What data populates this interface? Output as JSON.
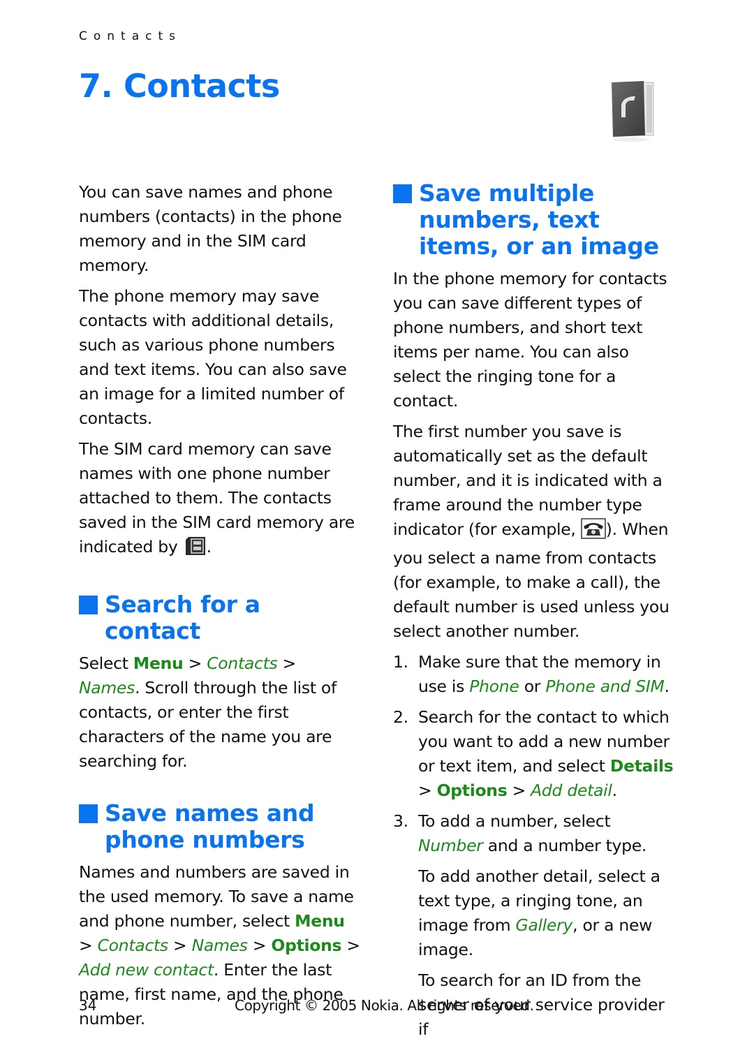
{
  "header": {
    "running_head": "Contacts",
    "chapter_title": "7. Contacts",
    "chapter_icon": "contacts-book-icon"
  },
  "colors": {
    "heading_blue": "#0A74F0",
    "menu_green": "#1B8A1B",
    "text": "#111111"
  },
  "left_column": {
    "intro_paragraphs": [
      "You can save names and phone numbers (contacts) in the phone memory and in the SIM card memory.",
      "The phone memory may save contacts with additional details, such as various phone numbers and text items. You can also save an image for a limited number of contacts."
    ],
    "sim_paragraph": {
      "text": "The SIM card memory can save names with one phone number attached to them. The contacts saved in the SIM card memory are indicated by",
      "icon": "sim-card-icon",
      "end": "."
    },
    "search_section": {
      "heading": "Search for a contact",
      "select": "Select",
      "menu": "Menu",
      "sep": ">",
      "contacts": "Contacts",
      "names": "Names",
      "rest": ". Scroll through the list of contacts, or enter the first characters of the name you are searching for."
    },
    "save_section": {
      "heading": "Save names and phone numbers",
      "text1": "Names and numbers are saved in the used memory. To save a name and phone number, select",
      "menu": "Menu",
      "contacts": "Contacts",
      "names": "Names",
      "options": "Options",
      "add_new_contact": "Add new contact",
      "text2": ". Enter the last name, first name, and the phone number."
    }
  },
  "right_column": {
    "heading": "Save multiple numbers, text items, or an image",
    "para1": "In the phone memory for contacts you can save different types of phone numbers, and short text items per name. You can also select the ringing tone for a contact.",
    "para2_start": "The first number you save is automatically set as the default number, and it is indicated with a frame around the number type indicator (for example,",
    "para2_icon": "phone-number-type-icon",
    "para2_end": "). When you select a name from contacts (for example, to make a call), the default number is used unless you select another number.",
    "steps": [
      {
        "num": "1.",
        "text1": "Make sure that the memory in use is",
        "phone": "Phone",
        "or": "or",
        "phone_and_sim": "Phone and SIM",
        "end": "."
      },
      {
        "num": "2.",
        "text1": "Search for the contact to which you want to add a new number or text item, and select",
        "details": "Details",
        "options": "Options",
        "add_detail": "Add detail",
        "end": "."
      },
      {
        "num": "3.",
        "text1": "To add a number, select",
        "number": "Number",
        "text2": "and a number type."
      }
    ],
    "sub_para1_start": "To add another detail, select a text type, a ringing tone, an image from",
    "gallery": "Gallery",
    "sub_para1_end": ", or a new image.",
    "sub_para2": "To search for an ID from the server of your service provider if"
  },
  "footer": {
    "page_number": "34",
    "copyright": "Copyright © 2005 Nokia. All rights reserved."
  }
}
